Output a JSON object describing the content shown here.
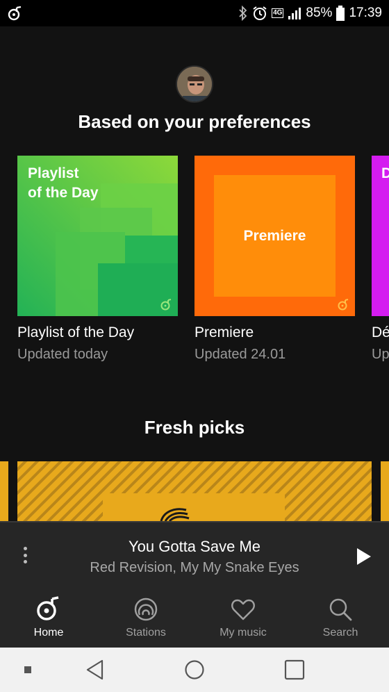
{
  "status_bar": {
    "network_label": "4G",
    "battery": "85%",
    "time": "17:39"
  },
  "home": {
    "section_preferences": "Based on your preferences",
    "section_fresh": "Fresh picks",
    "cards": [
      {
        "cover_text": "Playlist\nof the Day",
        "title": "Playlist of the Day",
        "subtitle": "Updated today",
        "color": "#3fbf4f"
      },
      {
        "cover_text": "Premiere",
        "title": "Premiere",
        "subtitle": "Updated 24.01",
        "color": "#ff6a0a"
      },
      {
        "cover_text": "D",
        "title": "Dé",
        "subtitle": "Up",
        "color": "#d41cf0"
      }
    ]
  },
  "player": {
    "track_title": "You Gotta Save Me",
    "track_artist": "Red Revision, My My Snake Eyes"
  },
  "nav": {
    "items": [
      {
        "label": "Home",
        "icon": "home-icon",
        "active": true
      },
      {
        "label": "Stations",
        "icon": "stations-icon",
        "active": false
      },
      {
        "label": "My music",
        "icon": "heart-icon",
        "active": false
      },
      {
        "label": "Search",
        "icon": "search-icon",
        "active": false
      }
    ]
  },
  "colors": {
    "background": "#121212",
    "player_bg": "#262626",
    "fresh_yellow": "#e8a91c"
  }
}
